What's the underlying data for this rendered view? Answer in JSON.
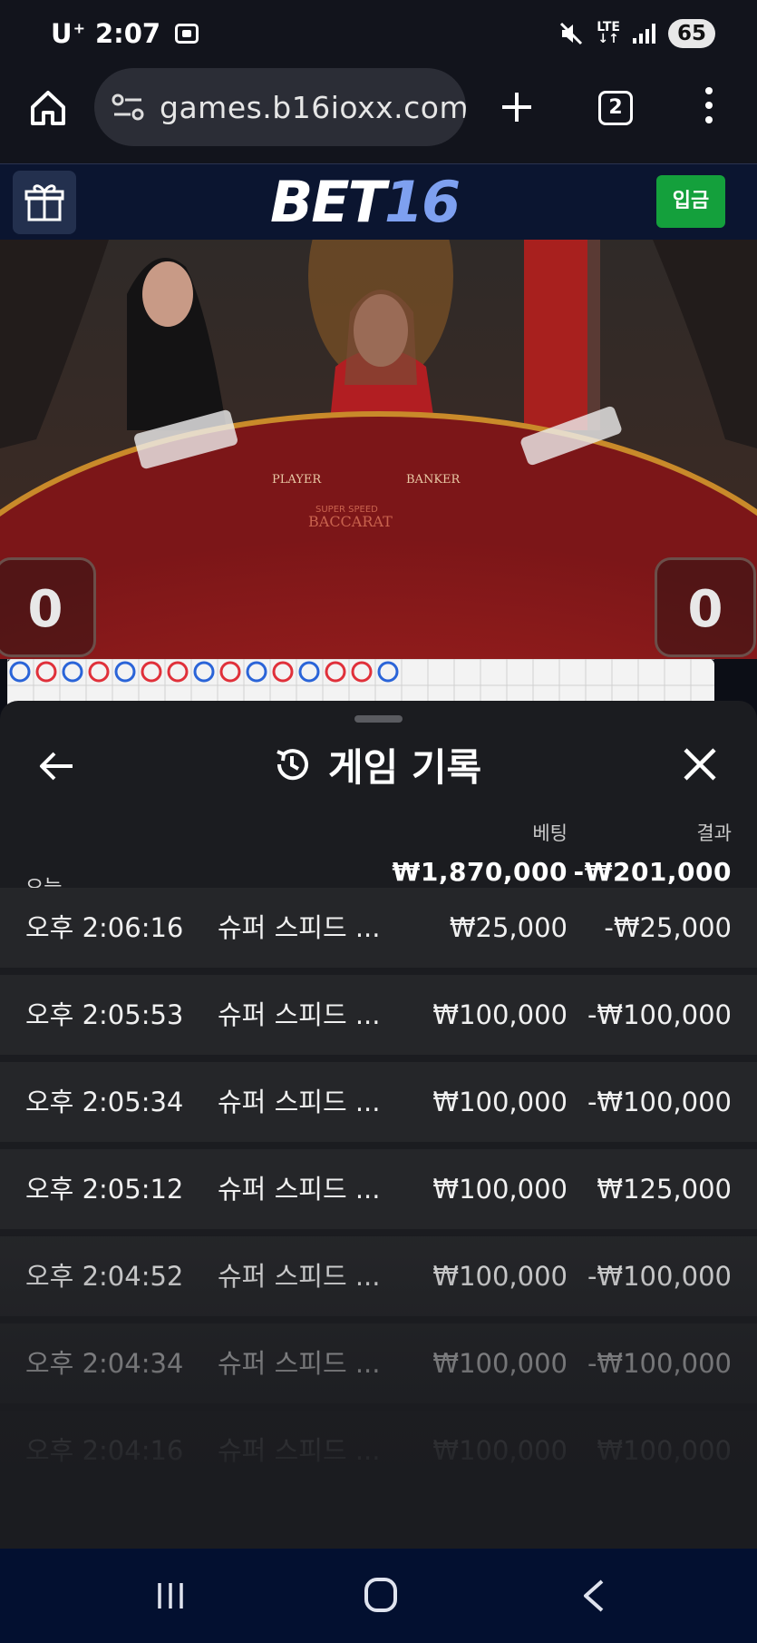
{
  "status_bar": {
    "carrier": "U",
    "carrier_sup": "+",
    "time": "2:07",
    "network": "LTE",
    "battery": "65"
  },
  "browser": {
    "url": "games.b16ioxx.com/",
    "tab_count": "2"
  },
  "site": {
    "logo_part1": "BET",
    "logo_part2": "16",
    "deposit_label": "입금"
  },
  "video": {
    "player_score": "0",
    "banker_score": "0",
    "table_labels": [
      "PLAYER",
      "BANKER",
      "SUPER SPEED",
      "BACCARAT"
    ]
  },
  "history": {
    "title": "게임 기록",
    "col_bet": "베팅",
    "col_result": "결과",
    "period_label": "오늘",
    "total_bet": "₩1,870,000",
    "total_result": "-₩201,000",
    "rows": [
      {
        "time": "오후 2:06:16",
        "game": "슈퍼 스피드 ...",
        "bet": "₩25,000",
        "result": "-₩25,000"
      },
      {
        "time": "오후 2:05:53",
        "game": "슈퍼 스피드 ...",
        "bet": "₩100,000",
        "result": "-₩100,000"
      },
      {
        "time": "오후 2:05:34",
        "game": "슈퍼 스피드 ...",
        "bet": "₩100,000",
        "result": "-₩100,000"
      },
      {
        "time": "오후 2:05:12",
        "game": "슈퍼 스피드 ...",
        "bet": "₩100,000",
        "result": "₩125,000"
      },
      {
        "time": "오후 2:04:52",
        "game": "슈퍼 스피드 ...",
        "bet": "₩100,000",
        "result": "-₩100,000"
      },
      {
        "time": "오후 2:04:34",
        "game": "슈퍼 스피드 ...",
        "bet": "₩100,000",
        "result": "-₩100,000"
      },
      {
        "time": "오후 2:04:16",
        "game": "슈퍼 스피드 ...",
        "bet": "₩100,000",
        "result": "₩100,000"
      }
    ]
  },
  "colors": {
    "brand_blue": "#7ea0f0",
    "deposit_green": "#14a03c",
    "road_red": "#e0303a",
    "road_blue": "#2a64d8"
  }
}
